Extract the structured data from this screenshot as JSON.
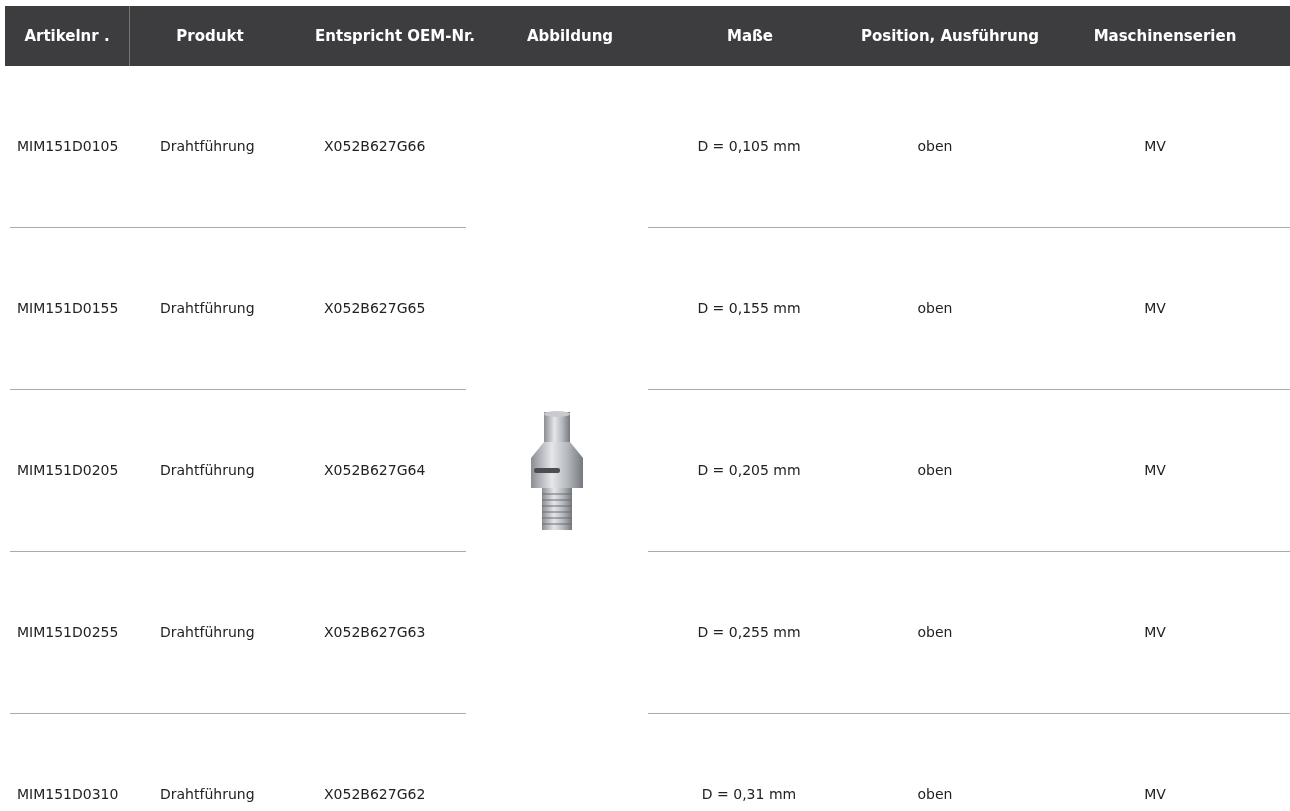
{
  "table": {
    "columns": [
      "Artikelnr .",
      "Produkt",
      "Entspricht OEM-Nr.",
      "Abbildung",
      "Maße",
      "Position, Ausführung",
      "Maschinenserien"
    ],
    "rows": [
      {
        "article": "MIM151D0105",
        "product": "Drahtführung",
        "oem": "X052B627G66",
        "dimensions": "D = 0,105 mm",
        "position": "oben",
        "series": "MV"
      },
      {
        "article": "MIM151D0155",
        "product": "Drahtführung",
        "oem": "X052B627G65",
        "dimensions": "D = 0,155 mm",
        "position": "oben",
        "series": "MV"
      },
      {
        "article": "MIM151D0205",
        "product": "Drahtführung",
        "oem": "X052B627G64",
        "dimensions": "D = 0,205 mm",
        "position": "oben",
        "series": "MV"
      },
      {
        "article": "MIM151D0255",
        "product": "Drahtführung",
        "oem": "X052B627G63",
        "dimensions": "D = 0,255 mm",
        "position": "oben",
        "series": "MV"
      },
      {
        "article": "MIM151D0310",
        "product": "Drahtführung",
        "oem": "X052B627G62",
        "dimensions": "D = 0,31 mm",
        "position": "oben",
        "series": "MV"
      }
    ]
  }
}
